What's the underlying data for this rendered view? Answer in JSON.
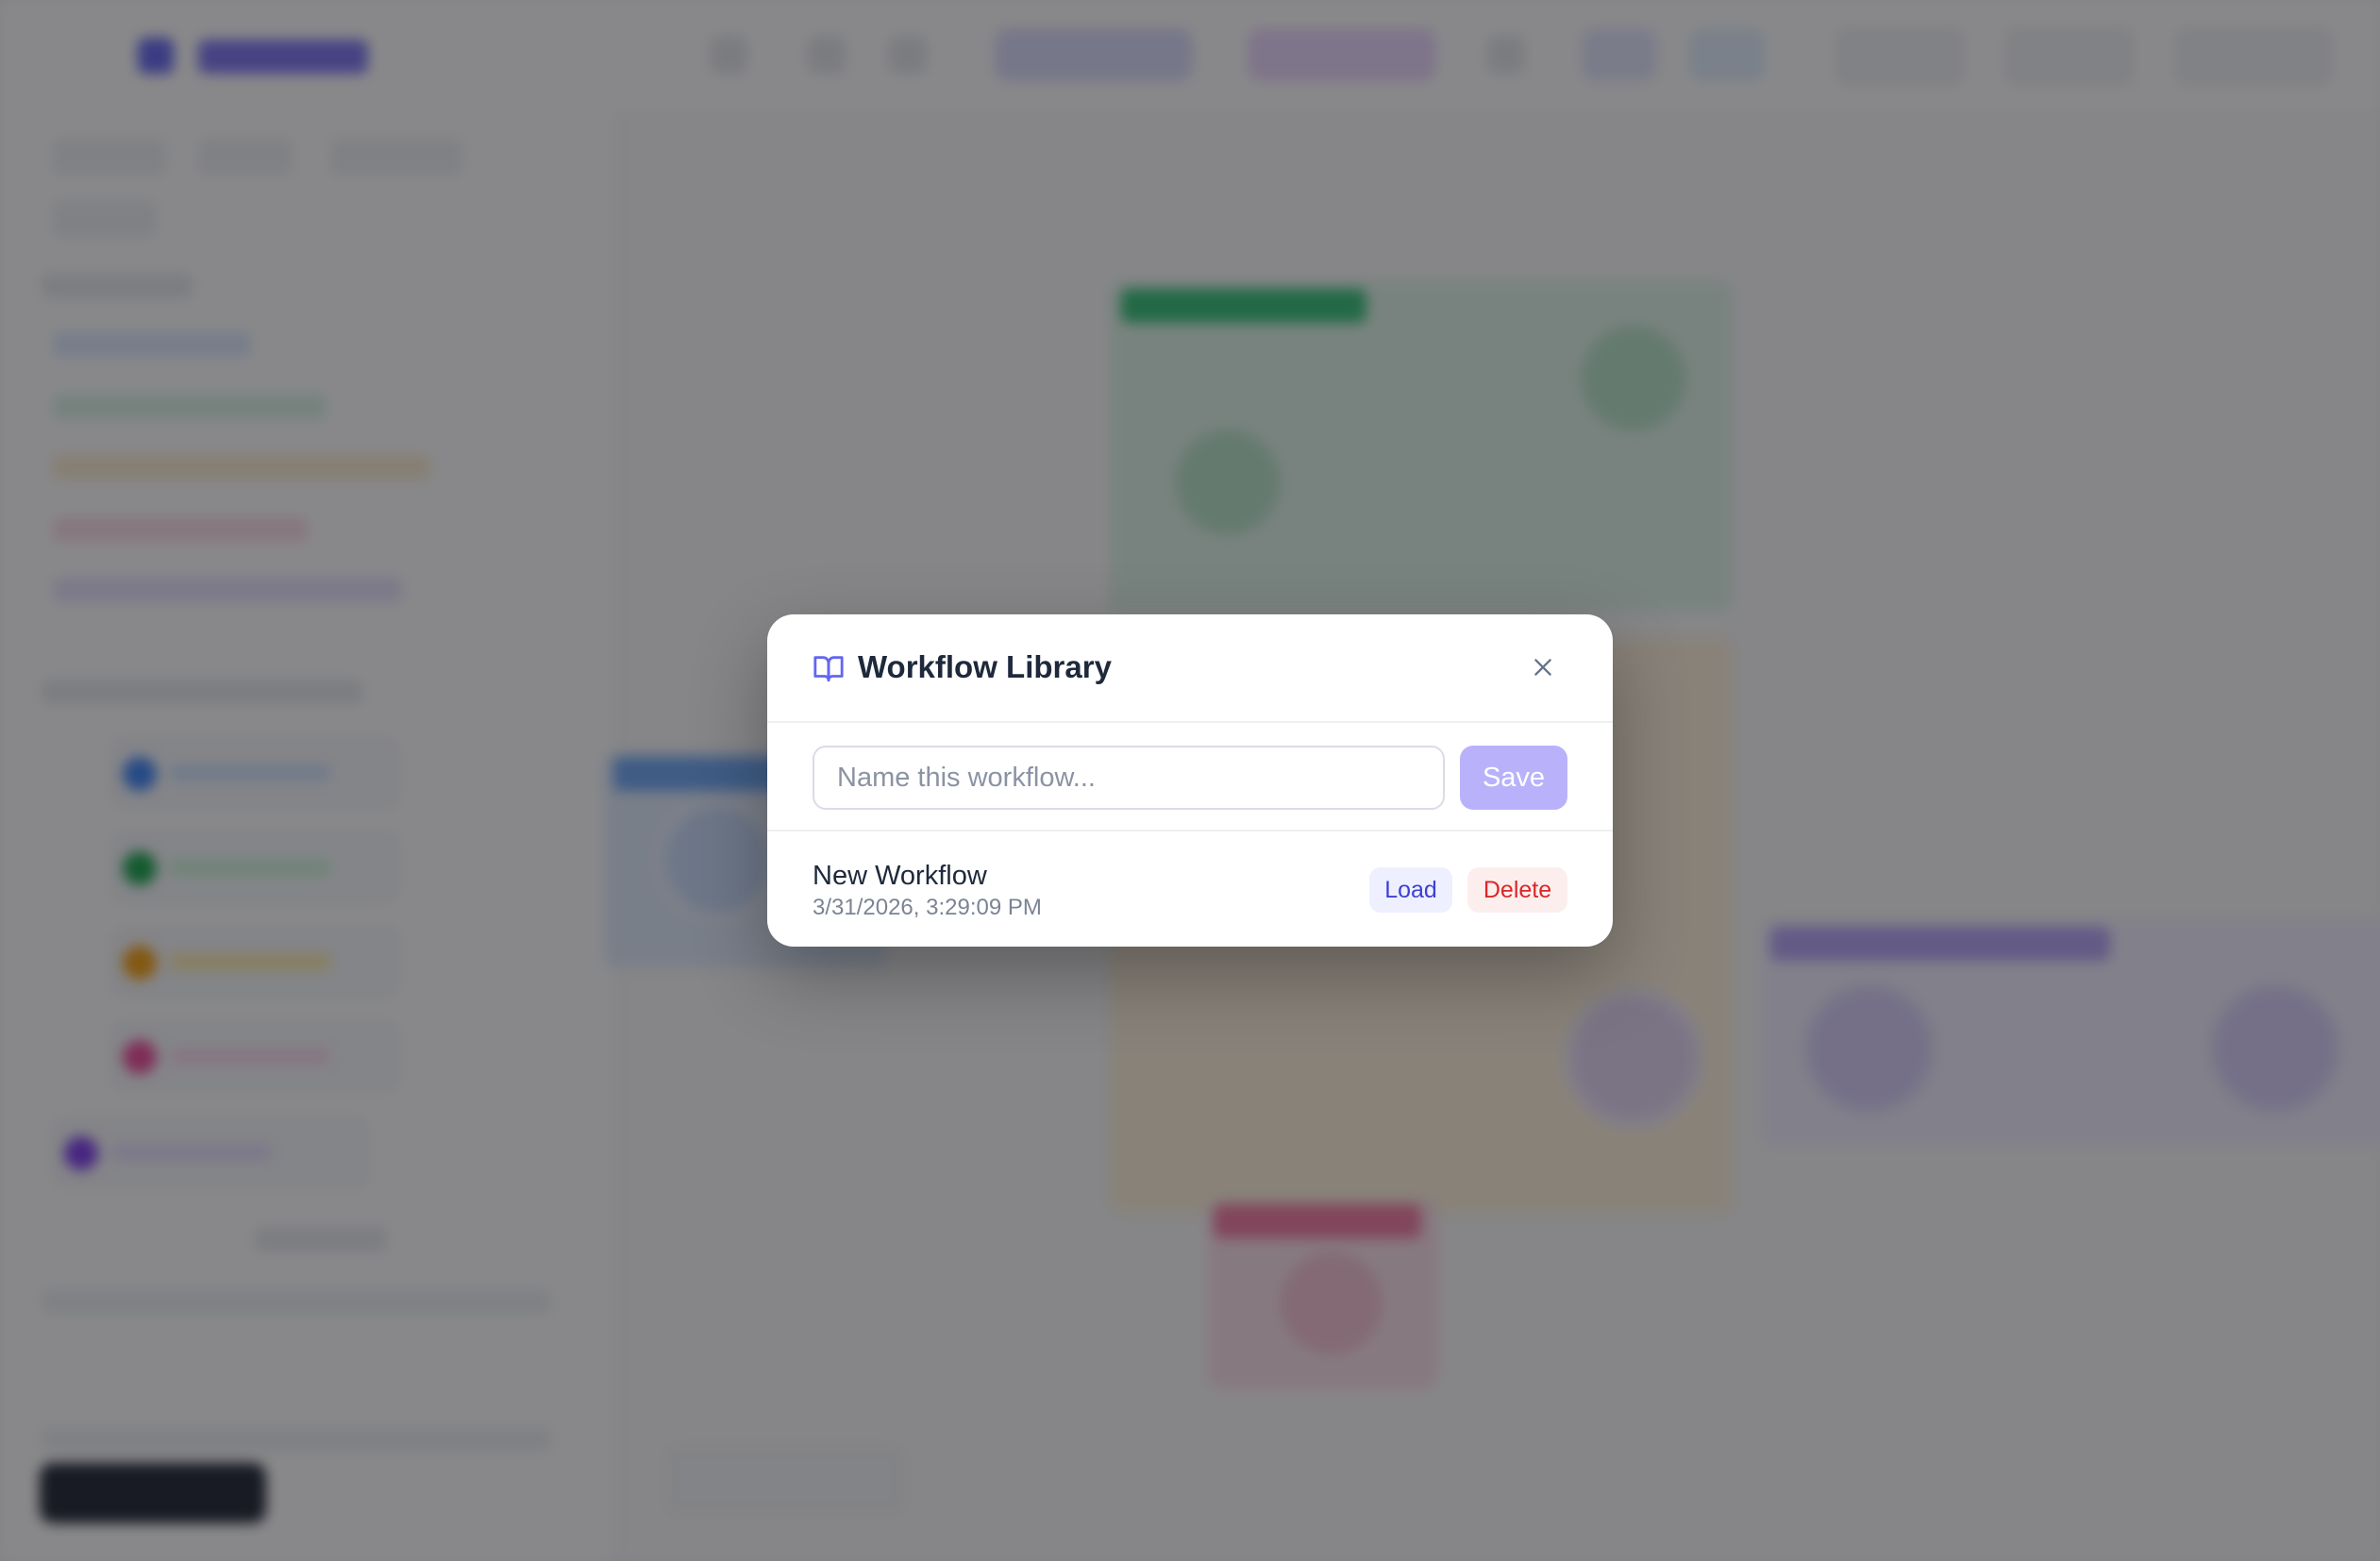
{
  "modal": {
    "title": "Workflow Library",
    "icon": "book-open-icon",
    "close_icon": "close-icon",
    "name_input": {
      "placeholder": "Name this workflow...",
      "value": ""
    },
    "save_label": "Save",
    "workflows": [
      {
        "name": "New Workflow",
        "date": "3/31/2026, 3:29:09 PM",
        "load_label": "Load",
        "delete_label": "Delete"
      }
    ]
  },
  "colors": {
    "accent": "#6366f1",
    "save_disabled": "#b9b2fb",
    "load_text": "#3f3fd4",
    "delete_text": "#dc2626",
    "overlay": "rgba(17,18,22,0.5)"
  }
}
